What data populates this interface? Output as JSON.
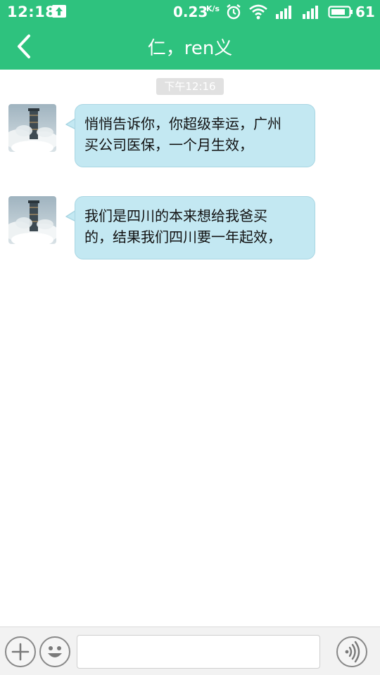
{
  "status_bar": {
    "time": "12:18",
    "net_speed": "0.23",
    "net_speed_unit": "K/s",
    "battery_level": "61",
    "icons": [
      "upload-icon",
      "alarm-icon",
      "wifi-icon",
      "signal-icon",
      "signal-icon",
      "battery-icon"
    ]
  },
  "header": {
    "title": "仁，ren义",
    "back_icon": "chevron-left-icon",
    "color": "#2ec27e"
  },
  "chat": {
    "timestamp": "下午12:16",
    "bubble_color": "#c3e8f2",
    "messages": [
      {
        "line1": "悄悄告诉你，你超级幸运，广州",
        "line2": "买公司医保，一个月生效，",
        "avatar_icon": "avatar-image"
      },
      {
        "line1": "我们是四川的本来想给我爸买",
        "line2": "的，结果我们四川要一年起效，",
        "avatar_icon": "avatar-image"
      }
    ]
  },
  "input_bar": {
    "value": "",
    "icons": [
      "plus-icon",
      "smiley-icon",
      "voice-icon"
    ]
  }
}
